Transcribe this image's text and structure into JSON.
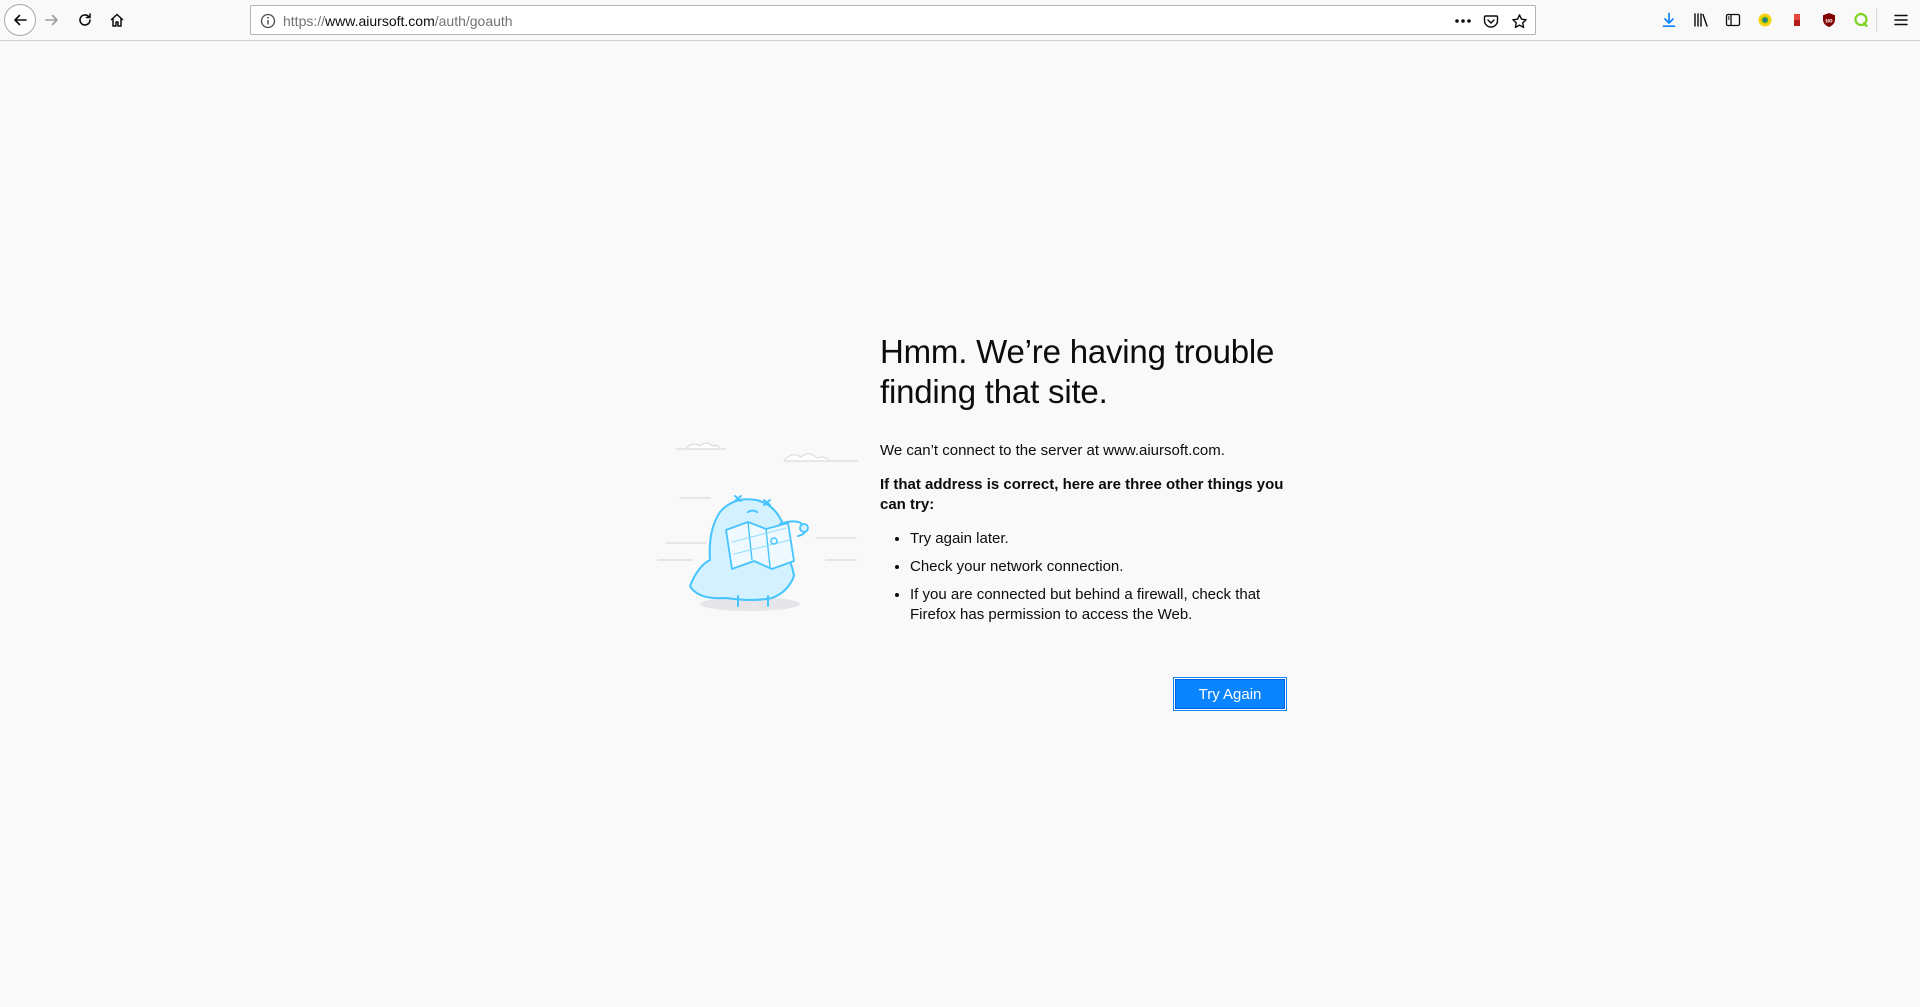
{
  "browser": {
    "url": {
      "scheme": "https://",
      "host": "www.aiursoft.com",
      "path": "/auth/goauth"
    },
    "toolbar_icons": [
      "back-icon",
      "forward-icon",
      "reload-icon",
      "home-icon"
    ],
    "page_action_icons": [
      "more-icon",
      "pocket-icon",
      "bookmark-star-icon"
    ],
    "right_icons": [
      "download-icon",
      "library-icon",
      "sidebar-icon",
      "extension-icon",
      "extension-icon",
      "ublock-icon",
      "extension-icon",
      "menu-icon"
    ]
  },
  "error_page": {
    "title": "Hmm. We’re having trouble finding that site.",
    "description": "We can’t connect to the server at www.aiursoft.com.",
    "advice_heading": "If that address is correct, here are three other things you can try:",
    "advice_items": [
      "Try again later.",
      "Check your network connection.",
      "If you are connected but behind a firewall, check that Firefox has permission to access the Web."
    ],
    "try_again_label": "Try Again"
  },
  "colors": {
    "accent": "#0a84ff",
    "background": "#f9f9fa",
    "illustration": "#45c4ff"
  }
}
